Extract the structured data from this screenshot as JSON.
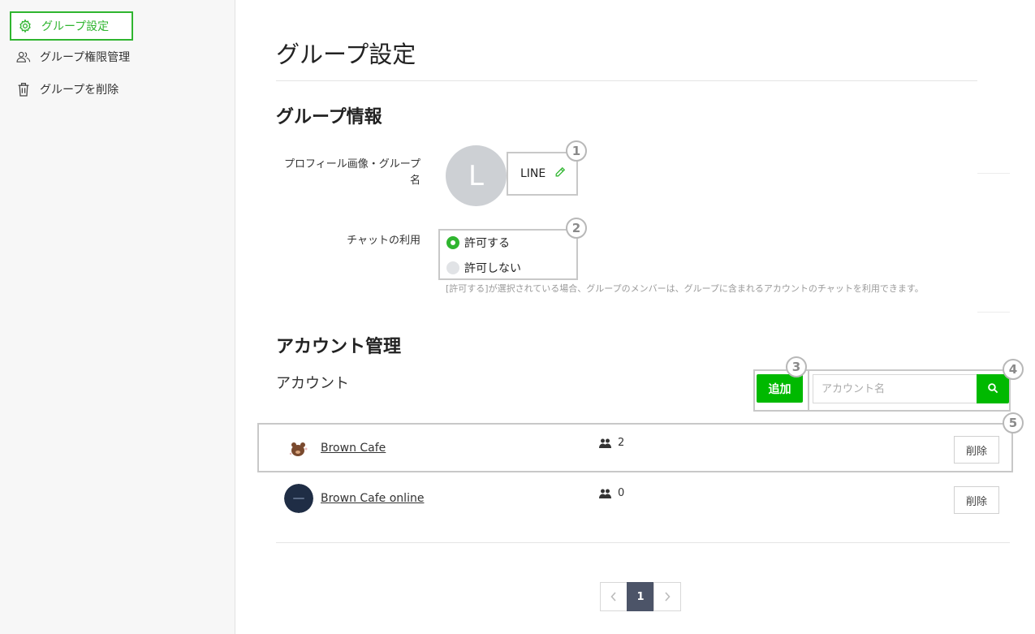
{
  "sidebar": {
    "items": [
      {
        "label": "グループ設定",
        "icon": "gear-icon",
        "active": true
      },
      {
        "label": "グループ権限管理",
        "icon": "users-icon",
        "active": false
      },
      {
        "label": "グループを削除",
        "icon": "trash-icon",
        "active": false
      }
    ]
  },
  "page": {
    "title": "グループ設定"
  },
  "group_info": {
    "section_title": "グループ情報",
    "profile_label": "プロフィール画像・グループ名",
    "avatar_letter": "L",
    "group_name": "LINE",
    "chat_label": "チャットの利用",
    "chat_options": [
      {
        "label": "許可する",
        "selected": true
      },
      {
        "label": "許可しない",
        "selected": false
      }
    ],
    "chat_help": "[許可する]が選択されている場合、グループのメンバーは、グループに含まれるアカウントのチャットを利用できます。"
  },
  "account_mgmt": {
    "section_title": "アカウント管理",
    "sub_title": "アカウント",
    "add_label": "追加",
    "search_placeholder": "アカウント名",
    "rows": [
      {
        "name": "Brown Cafe",
        "members": "2",
        "delete_label": "削除"
      },
      {
        "name": "Brown Cafe online",
        "members": "0",
        "delete_label": "削除"
      }
    ]
  },
  "callouts": [
    "1",
    "2",
    "3",
    "4",
    "5"
  ],
  "pagination": {
    "current": "1"
  },
  "colors": {
    "accent": "#00b900",
    "active_border": "#2fb52f",
    "pager_current": "#4c5468"
  }
}
